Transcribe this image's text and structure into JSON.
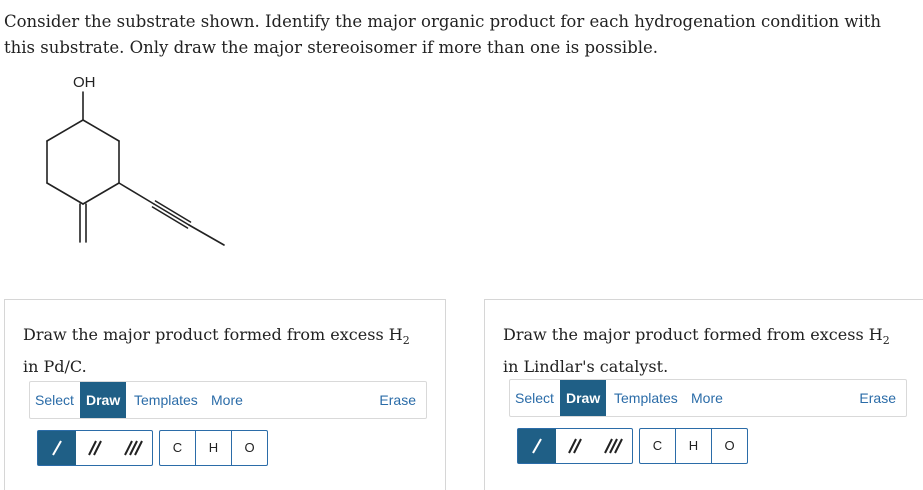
{
  "question": {
    "text": "Consider the substrate shown. Identify the major organic product for each hydrogenation condition with this substrate. Only draw the major stereoisomer if more than one is possible."
  },
  "molecule": {
    "oh_label": "OH"
  },
  "panels": [
    {
      "prompt_before": "Draw the major product formed from excess H",
      "prompt_sub": "2",
      "prompt_after": " in Pd/C.",
      "toolbar": {
        "select": "Select",
        "draw": "Draw",
        "templates": "Templates",
        "more": "More",
        "erase": "Erase"
      },
      "atoms": [
        "C",
        "H",
        "O"
      ]
    },
    {
      "prompt_before": "Draw the major product formed from excess H",
      "prompt_sub": "2",
      "prompt_after": " in Lindlar's catalyst.",
      "toolbar": {
        "select": "Select",
        "draw": "Draw",
        "templates": "Templates",
        "more": "More",
        "erase": "Erase"
      },
      "atoms": [
        "C",
        "H",
        "O"
      ]
    }
  ],
  "colors": {
    "accent": "#1f5f86",
    "link": "#2b6ca8",
    "border": "#d6d6d6"
  }
}
